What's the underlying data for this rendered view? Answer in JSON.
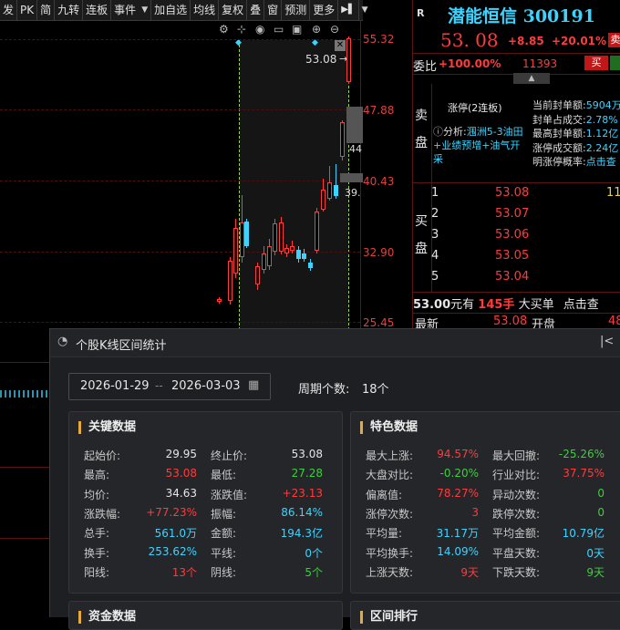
{
  "toolbar": {
    "items": [
      "发",
      "PK",
      "简",
      "九转",
      "连板",
      "事件",
      "加自选",
      "均线",
      "复权",
      "叠",
      "窗",
      "预测",
      "更多"
    ],
    "last_icon": "play-to-end-icon"
  },
  "chart": {
    "price_labels": [
      "55.32",
      "47.88",
      "40.43",
      "32.90",
      "25.45"
    ],
    "last_price_tag": "53.08",
    "tag_44": "44",
    "tag_39": "39."
  },
  "quote": {
    "badge": "R",
    "name": "潜能恒信 300191",
    "price": "53. 08",
    "change": "+8.85",
    "pct": "+20.01%",
    "sell_btn": "卖",
    "weibi_label": "委比",
    "weibi_value": "+100.00%",
    "weibi_count": "11393",
    "buy_btn": "买",
    "sell_side_label": "卖盘",
    "limit_tag": "涨停(2连板)",
    "analysis_label": "分析:",
    "analysis_text": "涠洲5-3油田+业绩预增+油气开采",
    "stats": [
      {
        "label": "当前封单额:",
        "value": "5904万"
      },
      {
        "label": "封单占成交:",
        "value": "2.78%"
      },
      {
        "label": "最高封单额:",
        "value": "1.12亿"
      },
      {
        "label": "涨停成交额:",
        "value": "2.24亿"
      },
      {
        "label": "明涨停概率:",
        "value": "点击查"
      }
    ],
    "buy_side_label": "买盘",
    "bids": [
      {
        "level": "1",
        "price": "53.08",
        "vol": "11"
      },
      {
        "level": "2",
        "price": "53.07",
        "vol": ""
      },
      {
        "level": "3",
        "price": "53.06",
        "vol": ""
      },
      {
        "level": "4",
        "price": "53.05",
        "vol": ""
      },
      {
        "level": "5",
        "price": "53.04",
        "vol": ""
      }
    ],
    "big_order": {
      "price": "53.00",
      "unit": "元有",
      "qty": "145手",
      "text": "大买单",
      "link": "点击查"
    },
    "last_row": {
      "label": "最新",
      "value": "53.08",
      "open_label": "开盘",
      "open_value": "48"
    }
  },
  "dialog": {
    "title": "个股K线区间统计",
    "start_date": "2026-01-29",
    "sep": "--",
    "end_date": "2026-03-03",
    "period_label": "周期个数:",
    "period_value": "18个",
    "key_panel": {
      "title": "关键数据",
      "rows": [
        [
          {
            "label": "起始价:",
            "value": "29.95",
            "color": "#e6e6e6"
          },
          {
            "label": "终止价:",
            "value": "53.08",
            "color": "#e6e6e6"
          }
        ],
        [
          {
            "label": "最高:",
            "value": "53.08",
            "color": "#ff3b3b"
          },
          {
            "label": "最低:",
            "value": "27.28",
            "color": "#3ccf3c"
          }
        ],
        [
          {
            "label": "均价:",
            "value": "34.63",
            "color": "#e6e6e6"
          },
          {
            "label": "涨跌值:",
            "value": "+23.13",
            "color": "#ff3b3b"
          }
        ],
        [
          {
            "label": "涨跌幅:",
            "value": "+77.23%",
            "color": "#ff3b3b"
          },
          {
            "label": "振幅:",
            "value": "86.14%",
            "color": "#3ed3ff"
          }
        ],
        [
          {
            "label": "总手:",
            "value": "561.0万",
            "color": "#3ed3ff"
          },
          {
            "label": "金额:",
            "value": "194.3亿",
            "color": "#3ed3ff"
          }
        ],
        [
          {
            "label": "换手:",
            "value": "253.62%",
            "color": "#3ed3ff"
          },
          {
            "label": "平线:",
            "value": "0个",
            "color": "#3ed3ff"
          }
        ],
        [
          {
            "label": "阳线:",
            "value": "13个",
            "color": "#ff3b3b"
          },
          {
            "label": "阴线:",
            "value": "5个",
            "color": "#3ccf3c"
          }
        ]
      ]
    },
    "special_panel": {
      "title": "特色数据",
      "rows": [
        [
          {
            "label": "最大上涨:",
            "value": "94.57%",
            "color": "#ff3b3b"
          },
          {
            "label": "最大回撤:",
            "value": "-25.26%",
            "color": "#3ccf3c"
          }
        ],
        [
          {
            "label": "大盘对比:",
            "value": "-0.20%",
            "color": "#3ccf3c"
          },
          {
            "label": "行业对比:",
            "value": "37.75%",
            "color": "#ff3b3b"
          }
        ],
        [
          {
            "label": "偏离值:",
            "value": "78.27%",
            "color": "#ff3b3b"
          },
          {
            "label": "异动次数:",
            "value": "0",
            "color": "#3ccf3c"
          }
        ],
        [
          {
            "label": "涨停次数:",
            "value": "3",
            "color": "#ff3b3b"
          },
          {
            "label": "跌停次数:",
            "value": "0",
            "color": "#3ccf3c"
          }
        ],
        [
          {
            "label": "平均量:",
            "value": "31.17万",
            "color": "#3ed3ff"
          },
          {
            "label": "平均金额:",
            "value": "10.79亿",
            "color": "#3ed3ff"
          }
        ],
        [
          {
            "label": "平均换手:",
            "value": "14.09%",
            "color": "#3ed3ff"
          },
          {
            "label": "平盘天数:",
            "value": "0天",
            "color": "#3ed3ff"
          }
        ],
        [
          {
            "label": "上涨天数:",
            "value": "9天",
            "color": "#ff3b3b"
          },
          {
            "label": "下跌天数:",
            "value": "9天",
            "color": "#3ccf3c"
          }
        ]
      ]
    },
    "bottom_left_title": "资金数据",
    "bottom_right_title": "区间排行"
  }
}
